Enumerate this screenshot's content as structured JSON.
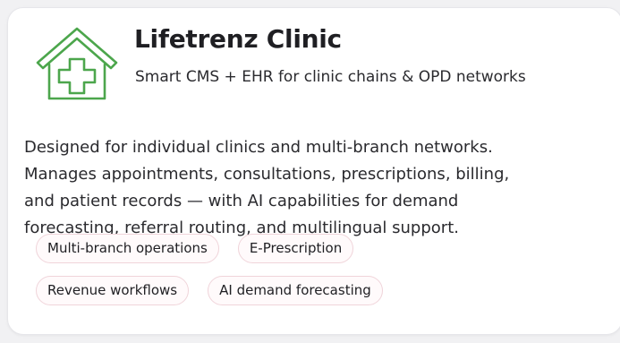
{
  "card": {
    "title": "Lifetrenz Clinic",
    "subtitle": "Smart CMS + EHR for clinic chains & OPD networks",
    "description_lines": [
      "Designed for individual clinics and multi-branch networks.",
      "Manages appointments, consultations, prescriptions, billing,",
      "and patient records — with AI capabilities for demand",
      "forecasting, referral routing, and multilingual support."
    ],
    "logo_icon": "clinic-house-cross-icon",
    "tags": [
      [
        "Multi-branch operations",
        "E-Prescription"
      ],
      [
        "Revenue workflows",
        "AI demand forecasting"
      ]
    ]
  },
  "colors": {
    "accent_green": "#4ca64c",
    "tag_border": "#f0d4da",
    "text": "#2a2a2e"
  }
}
